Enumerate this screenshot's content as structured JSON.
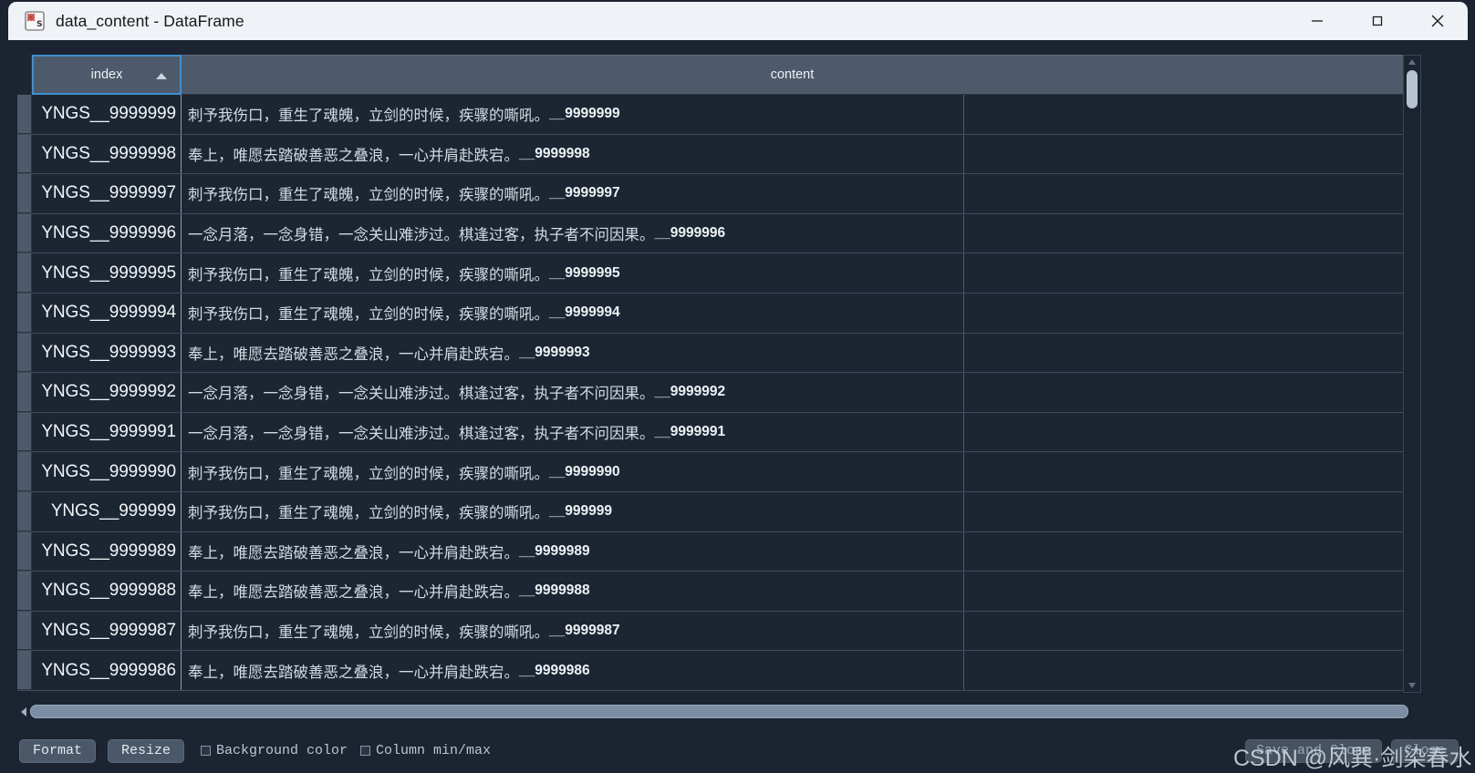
{
  "window": {
    "title": "data_content - DataFrame",
    "app_icon": "spyder-variable-explorer-icon",
    "controls": {
      "minimize": "—",
      "maximize": "□",
      "close": "✕"
    }
  },
  "table": {
    "columns": [
      {
        "id": "index",
        "label": "index",
        "sorted": true,
        "sort_direction": "ascending"
      },
      {
        "id": "content",
        "label": "content"
      }
    ],
    "rows": [
      {
        "index": "YNGS__9999999",
        "content_text": "刺予我伤口，重生了魂魄，立剑的时候，疾骤的嘶吼。",
        "content_suffix": "__9999999"
      },
      {
        "index": "YNGS__9999998",
        "content_text": "奉上，唯愿去踏破善恶之叠浪，一心并肩赴跌宕。",
        "content_suffix": "__9999998"
      },
      {
        "index": "YNGS__9999997",
        "content_text": "刺予我伤口，重生了魂魄，立剑的时候，疾骤的嘶吼。",
        "content_suffix": "__9999997"
      },
      {
        "index": "YNGS__9999996",
        "content_text": "一念月落，一念身错，一念关山难涉过。棋逢过客，执子者不问因果。",
        "content_suffix": "__9999996"
      },
      {
        "index": "YNGS__9999995",
        "content_text": "刺予我伤口，重生了魂魄，立剑的时候，疾骤的嘶吼。",
        "content_suffix": "__9999995"
      },
      {
        "index": "YNGS__9999994",
        "content_text": "刺予我伤口，重生了魂魄，立剑的时候，疾骤的嘶吼。",
        "content_suffix": "__9999994"
      },
      {
        "index": "YNGS__9999993",
        "content_text": "奉上，唯愿去踏破善恶之叠浪，一心并肩赴跌宕。",
        "content_suffix": "__9999993"
      },
      {
        "index": "YNGS__9999992",
        "content_text": "一念月落，一念身错，一念关山难涉过。棋逢过客，执子者不问因果。",
        "content_suffix": "__9999992"
      },
      {
        "index": "YNGS__9999991",
        "content_text": "一念月落，一念身错，一念关山难涉过。棋逢过客，执子者不问因果。",
        "content_suffix": "__9999991"
      },
      {
        "index": "YNGS__9999990",
        "content_text": "刺予我伤口，重生了魂魄，立剑的时候，疾骤的嘶吼。",
        "content_suffix": "__9999990"
      },
      {
        "index": "YNGS__999999",
        "content_text": "刺予我伤口，重生了魂魄，立剑的时候，疾骤的嘶吼。",
        "content_suffix": "__999999"
      },
      {
        "index": "YNGS__9999989",
        "content_text": "奉上，唯愿去踏破善恶之叠浪，一心并肩赴跌宕。",
        "content_suffix": "__9999989"
      },
      {
        "index": "YNGS__9999988",
        "content_text": "奉上，唯愿去踏破善恶之叠浪，一心并肩赴跌宕。",
        "content_suffix": "__9999988"
      },
      {
        "index": "YNGS__9999987",
        "content_text": "刺予我伤口，重生了魂魄，立剑的时候，疾骤的嘶吼。",
        "content_suffix": "__9999987"
      },
      {
        "index": "YNGS__9999986",
        "content_text": "奉上，唯愿去踏破善恶之叠浪，一心并肩赴跌宕。",
        "content_suffix": "__9999986"
      }
    ]
  },
  "scrollbars": {
    "vertical": {
      "up_arrow": "▲",
      "down_arrow": "▼",
      "thumb_position": "top"
    },
    "horizontal": {
      "left_arrow": "◀",
      "right_arrow": "▶",
      "thumb_position": "full"
    }
  },
  "bottom_bar": {
    "format_button": "Format",
    "resize_button": "Resize",
    "background_color_checkbox": "Background color",
    "background_color_checked": false,
    "column_minmax_checkbox": "Column min/max",
    "column_minmax_checked": false,
    "save_and_close_button": "Save and Close",
    "close_button": "Close"
  },
  "watermark": {
    "text": "CSDN @风巽·剑染春水"
  },
  "colors": {
    "titlebar_bg": "#eff2f7",
    "window_bg": "#1b2430",
    "header_bg": "#4d5a6b",
    "cell_bg": "#1c2633",
    "selection_border": "#3f8fd0",
    "text_light": "#d4dae1"
  }
}
